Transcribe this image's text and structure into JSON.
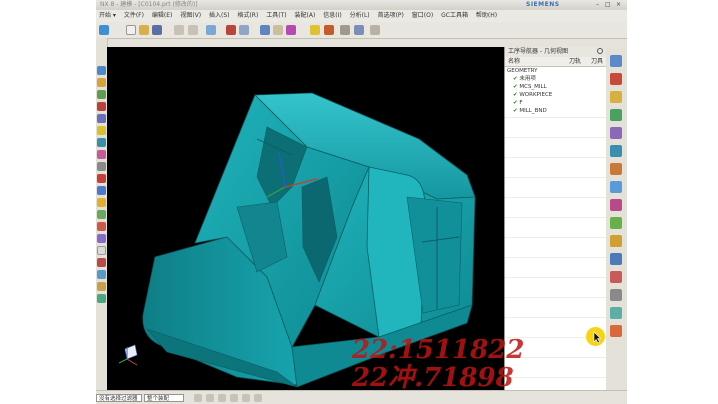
{
  "window": {
    "title": "NX 8 - 建模 - [C0104.prt (修改的)]",
    "brand": "SIEMENS",
    "controls": [
      "–",
      "□",
      "×"
    ]
  },
  "menu": [
    "开始 ▾",
    "文件(F)",
    "编辑(E)",
    "视图(V)",
    "插入(S)",
    "格式(R)",
    "工具(T)",
    "装配(A)",
    "信息(I)",
    "分析(L)",
    "首选项(P)",
    "窗口(O)",
    "GC工具箱",
    "帮助(H)"
  ],
  "navigator": {
    "title": "工序导航器 - 几何视图",
    "columns": [
      "名称",
      "刀轨",
      "刀具"
    ],
    "rows": [
      "GEOMETRY",
      "未用项",
      "MCS_MILL",
      "WORKPIECE",
      "F",
      "MILL_BND"
    ]
  },
  "statusbar": {
    "filter_label": "没有选择过滤器",
    "assembly_label": "整个装配"
  },
  "watermark": {
    "line1": "22:1511822",
    "line2": "22冲.71898"
  },
  "colors": {
    "background": "#000000",
    "part": "#1aa3ab",
    "watermark": "#c21818"
  }
}
